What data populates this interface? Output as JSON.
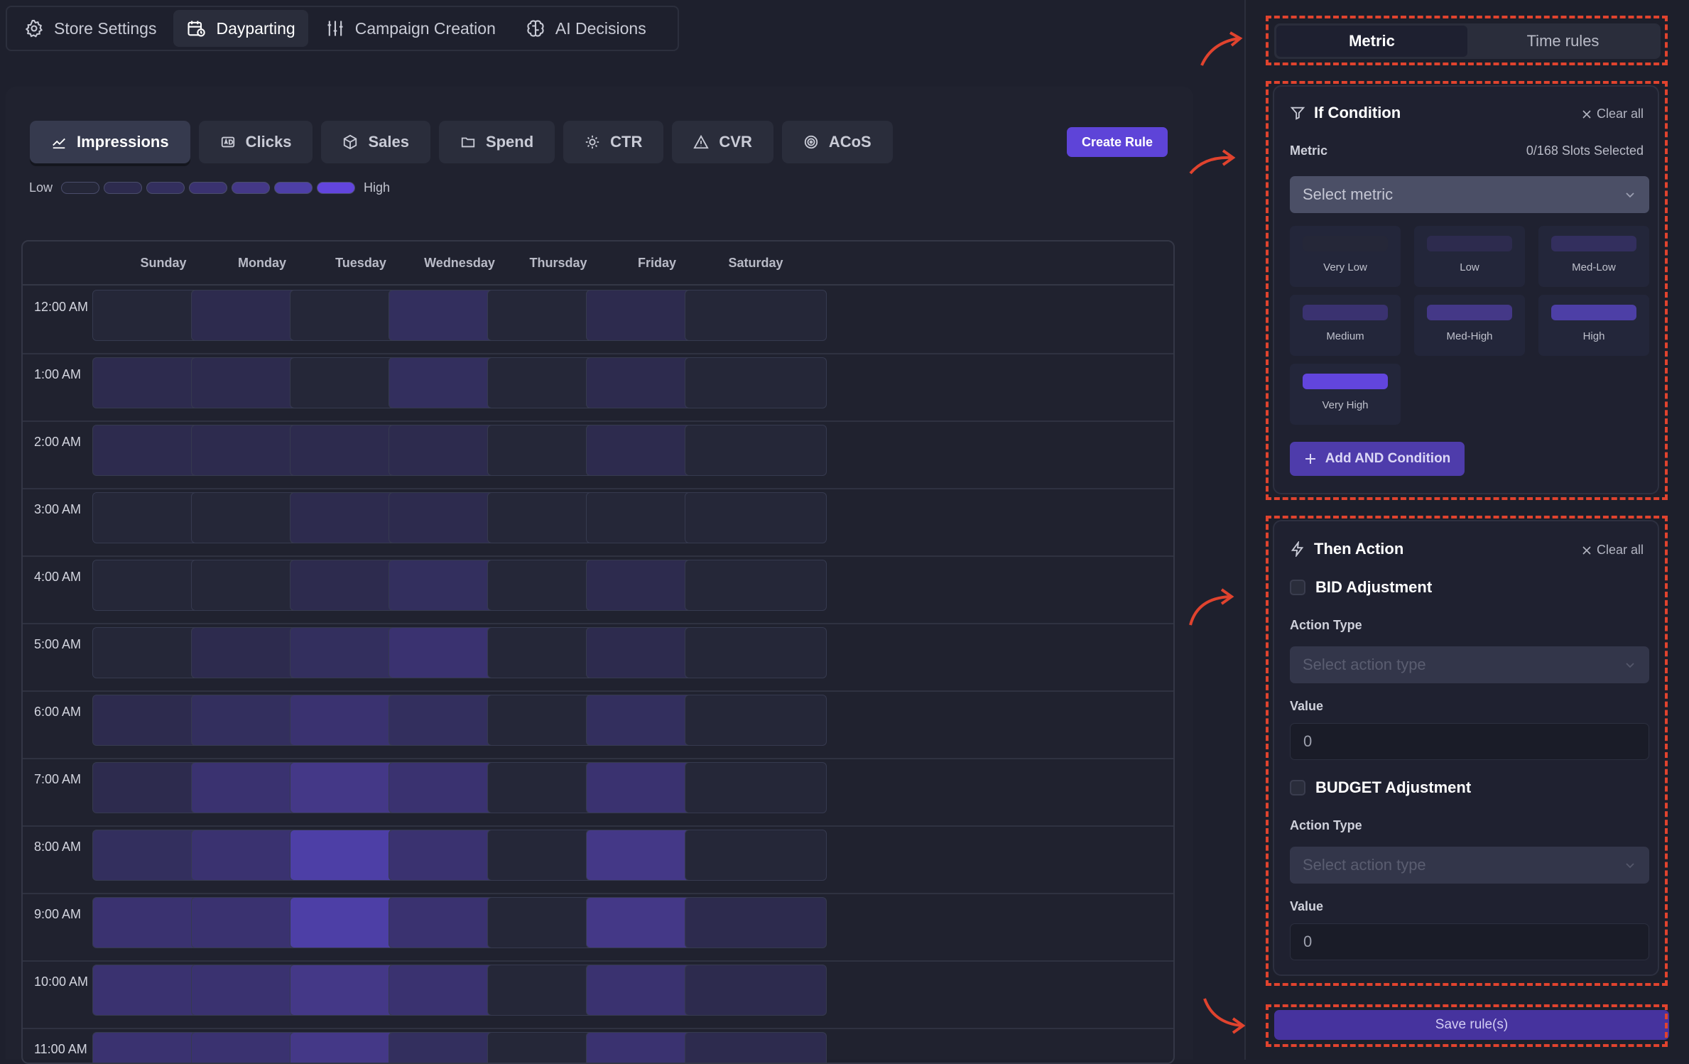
{
  "top_nav": {
    "tabs": [
      {
        "label": "Store Settings",
        "icon": "gear-icon"
      },
      {
        "label": "Dayparting",
        "icon": "calendar-clock-icon",
        "active": true
      },
      {
        "label": "Campaign Creation",
        "icon": "sliders-icon"
      },
      {
        "label": "AI Decisions",
        "icon": "brain-icon"
      }
    ]
  },
  "metrics": {
    "tabs": [
      {
        "label": "Impressions",
        "icon": "trend-chart-icon",
        "active": true
      },
      {
        "label": "Clicks",
        "icon": "ad-icon"
      },
      {
        "label": "Sales",
        "icon": "box-icon"
      },
      {
        "label": "Spend",
        "icon": "folder-icon"
      },
      {
        "label": "CTR",
        "icon": "sparkle-icon"
      },
      {
        "label": "CVR",
        "icon": "warning-triangle-icon"
      },
      {
        "label": "ACoS",
        "icon": "target-icon"
      }
    ],
    "create_rule_label": "Create Rule"
  },
  "legend": {
    "low_label": "Low",
    "high_label": "High",
    "scale_colors": [
      "#252738",
      "#2d2b4e",
      "#332f5e",
      "#3a3270",
      "#443887",
      "#4d3fa6",
      "#6245dd"
    ]
  },
  "schedule": {
    "days": [
      "Sunday",
      "Monday",
      "Tuesday",
      "Wednesday",
      "Thursday",
      "Friday",
      "Saturday"
    ],
    "level_scale": "0 = lowest, 6 = highest",
    "rows": [
      {
        "time": "12:00 AM",
        "levels": [
          0,
          1,
          0,
          2,
          0,
          1,
          0
        ]
      },
      {
        "time": "1:00 AM",
        "levels": [
          1,
          1,
          0,
          2,
          0,
          1,
          0
        ]
      },
      {
        "time": "2:00 AM",
        "levels": [
          1,
          1,
          1,
          1,
          0,
          1,
          0
        ]
      },
      {
        "time": "3:00 AM",
        "levels": [
          0,
          0,
          1,
          1,
          0,
          0,
          0
        ]
      },
      {
        "time": "4:00 AM",
        "levels": [
          0,
          0,
          1,
          2,
          0,
          1,
          0
        ]
      },
      {
        "time": "5:00 AM",
        "levels": [
          0,
          1,
          2,
          3,
          0,
          1,
          0
        ]
      },
      {
        "time": "6:00 AM",
        "levels": [
          1,
          2,
          3,
          2,
          0,
          2,
          0
        ]
      },
      {
        "time": "7:00 AM",
        "levels": [
          1,
          3,
          4,
          3,
          0,
          3,
          0
        ]
      },
      {
        "time": "8:00 AM",
        "levels": [
          2,
          3,
          5,
          3,
          0,
          4,
          0
        ]
      },
      {
        "time": "9:00 AM",
        "levels": [
          3,
          3,
          5,
          3,
          0,
          4,
          1
        ]
      },
      {
        "time": "10:00 AM",
        "levels": [
          3,
          3,
          4,
          3,
          0,
          3,
          1
        ]
      },
      {
        "time": "11:00 AM",
        "levels": [
          3,
          3,
          4,
          2,
          0,
          3,
          1
        ]
      }
    ]
  },
  "side_panel": {
    "tabs": [
      {
        "label": "Metric",
        "active": true
      },
      {
        "label": "Time rules"
      }
    ],
    "if_condition": {
      "title": "If Condition",
      "clear_all": "Clear all",
      "metric_label": "Metric",
      "slots_selected": "0/168 Slots Selected",
      "select_placeholder": "Select metric",
      "levels": [
        {
          "name": "Very Low",
          "color": "#252738"
        },
        {
          "name": "Low",
          "color": "#2d2b4e"
        },
        {
          "name": "Med-Low",
          "color": "#332f5e"
        },
        {
          "name": "Medium",
          "color": "#3a3270"
        },
        {
          "name": "Med-High",
          "color": "#443887"
        },
        {
          "name": "High",
          "color": "#4d3fa6"
        },
        {
          "name": "Very High",
          "color": "#6245dd"
        }
      ],
      "add_and_label": "Add AND Condition"
    },
    "then_action": {
      "title": "Then Action",
      "clear_all": "Clear all",
      "bid": {
        "label": "BID Adjustment",
        "action_type_label": "Action Type",
        "action_type_placeholder": "Select action type",
        "value_label": "Value",
        "value": "0"
      },
      "budget": {
        "label": "BUDGET Adjustment",
        "action_type_label": "Action Type",
        "action_type_placeholder": "Select action type",
        "value_label": "Value",
        "value": "0"
      }
    },
    "save_label": "Save rule(s)"
  },
  "colors": {
    "accent": "#5e44d8",
    "annotation": "#e0432e",
    "background": "#1e202d"
  }
}
